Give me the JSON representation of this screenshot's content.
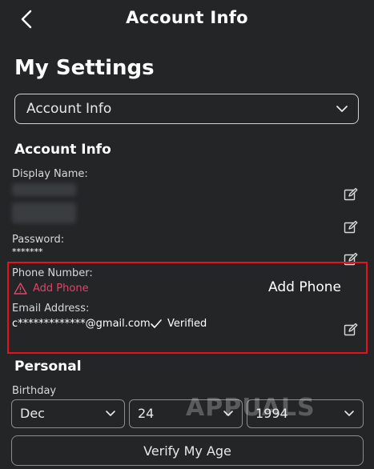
{
  "header": {
    "title": "Account Info",
    "back_icon": "chevron-left-icon"
  },
  "page": {
    "title": "My Settings"
  },
  "menu_select": {
    "selected": "Account Info"
  },
  "account": {
    "section_title": "Account Info",
    "display_name_label": "Display Name:",
    "password_label": "Password:",
    "password_value": "*******",
    "phone_label": "Phone Number:",
    "phone_action": "Add Phone",
    "phone_annotation": "Add Phone",
    "email_label": "Email Address:",
    "email_value": "c*************@gmail.com",
    "email_status": "Verified"
  },
  "personal": {
    "section_title": "Personal",
    "birthday_label": "Birthday",
    "month": "Dec",
    "day": "24",
    "year": "1994"
  },
  "verify_button": "Verify My Age",
  "watermark": "APPUALS",
  "colors": {
    "background": "#232527",
    "highlight": "#e8101a",
    "warning": "#e0456a"
  }
}
